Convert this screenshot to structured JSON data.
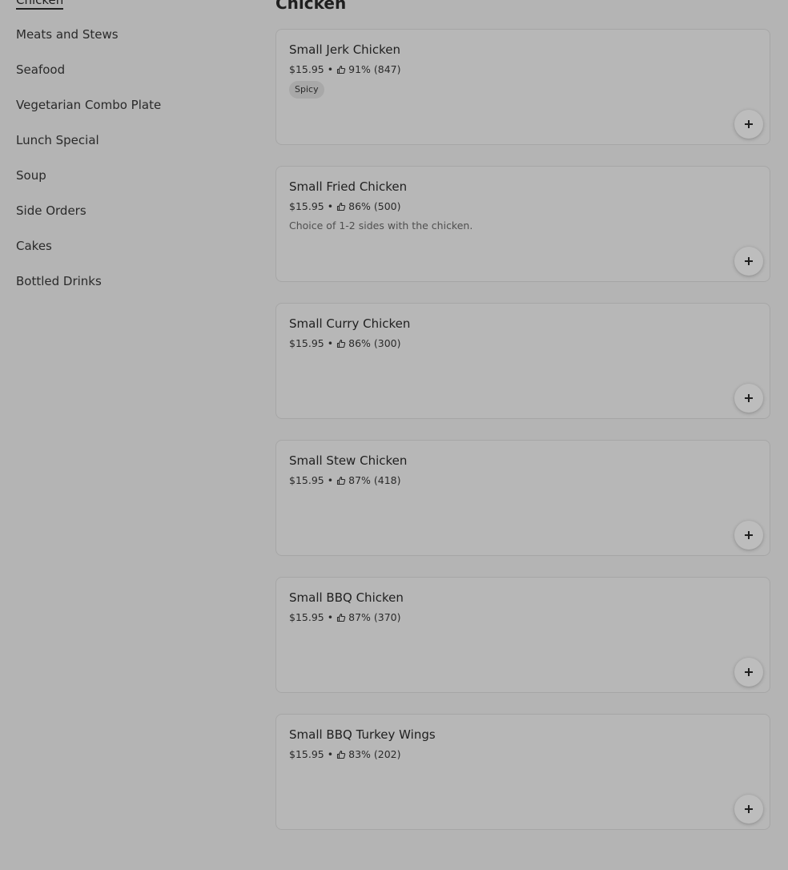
{
  "sidebar": {
    "active_category": "Chicken",
    "categories": [
      "Meats and Stews",
      "Seafood",
      "Vegetarian Combo Plate",
      "Lunch Special",
      "Soup",
      "Side Orders",
      "Cakes",
      "Bottled Drinks"
    ]
  },
  "section": {
    "title": "Chicken"
  },
  "items": [
    {
      "name": "Small Jerk Chicken",
      "price": "$15.95",
      "separator": "•",
      "rating": "91% (847)",
      "badge": "Spicy",
      "description": ""
    },
    {
      "name": "Small Fried Chicken",
      "price": "$15.95",
      "separator": "•",
      "rating": "86% (500)",
      "badge": "",
      "description": "Choice of 1-2 sides with the chicken."
    },
    {
      "name": "Small Curry Chicken",
      "price": "$15.95",
      "separator": "•",
      "rating": "86% (300)",
      "badge": "",
      "description": ""
    },
    {
      "name": "Small Stew Chicken",
      "price": "$15.95",
      "separator": "•",
      "rating": "87% (418)",
      "badge": "",
      "description": ""
    },
    {
      "name": "Small BBQ Chicken",
      "price": "$15.95",
      "separator": "•",
      "rating": "87% (370)",
      "badge": "",
      "description": ""
    },
    {
      "name": "Small BBQ Turkey Wings",
      "price": "$15.95",
      "separator": "•",
      "rating": "83% (202)",
      "badge": "",
      "description": ""
    }
  ],
  "icons": {
    "rating": "thumbs-up-icon",
    "add": "plus-icon"
  },
  "colors": {
    "overlay_background": "#b4b4b4",
    "text": "#1f1f1f"
  }
}
